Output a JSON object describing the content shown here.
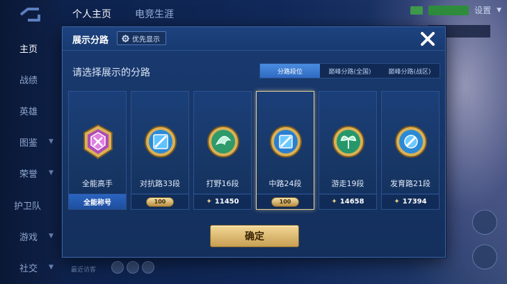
{
  "top_tabs": [
    {
      "label": "个人主页"
    },
    {
      "label": "电竞生涯"
    }
  ],
  "top_bar": {
    "settings_label": "设置"
  },
  "sidebar": {
    "items": [
      {
        "label": "主页"
      },
      {
        "label": "战绩"
      },
      {
        "label": "英雄"
      },
      {
        "label": "图鉴"
      },
      {
        "label": "荣誉"
      },
      {
        "label": "护卫队"
      },
      {
        "label": "游戏"
      },
      {
        "label": "社交"
      }
    ]
  },
  "bottom": {
    "recent_label": "最近访客"
  },
  "modal": {
    "title": "展示分路",
    "priority_button": "优先显示",
    "prompt": "请选择展示的分路",
    "segments": [
      {
        "label": "分路段位",
        "active": true
      },
      {
        "label": "巅峰分路(全国)",
        "active": false
      },
      {
        "label": "巅峰分路(战区)",
        "active": false
      }
    ],
    "cards": [
      {
        "icon": "all-round-emblem-icon",
        "label": "全能高手",
        "footer": "全能称号",
        "footer_type": "text",
        "selected": false
      },
      {
        "icon": "clash-lane-emblem-icon",
        "label": "对抗路33段",
        "footer": "100",
        "footer_type": "medal",
        "selected": false
      },
      {
        "icon": "jungle-emblem-icon",
        "label": "打野16段",
        "footer": "11450",
        "footer_type": "score",
        "selected": false
      },
      {
        "icon": "mid-lane-emblem-icon",
        "label": "中路24段",
        "footer": "100",
        "footer_type": "medal",
        "selected": true
      },
      {
        "icon": "roam-emblem-icon",
        "label": "游走19段",
        "footer": "14658",
        "footer_type": "score",
        "selected": false
      },
      {
        "icon": "farm-lane-emblem-icon",
        "label": "发育路21段",
        "footer": "17394",
        "footer_type": "score",
        "selected": false
      }
    ],
    "confirm_label": "确定"
  },
  "colors": {
    "accent_gold": "#e9cf8c",
    "active_blue": "#3a7bd5",
    "modal_bg": "#173566"
  }
}
